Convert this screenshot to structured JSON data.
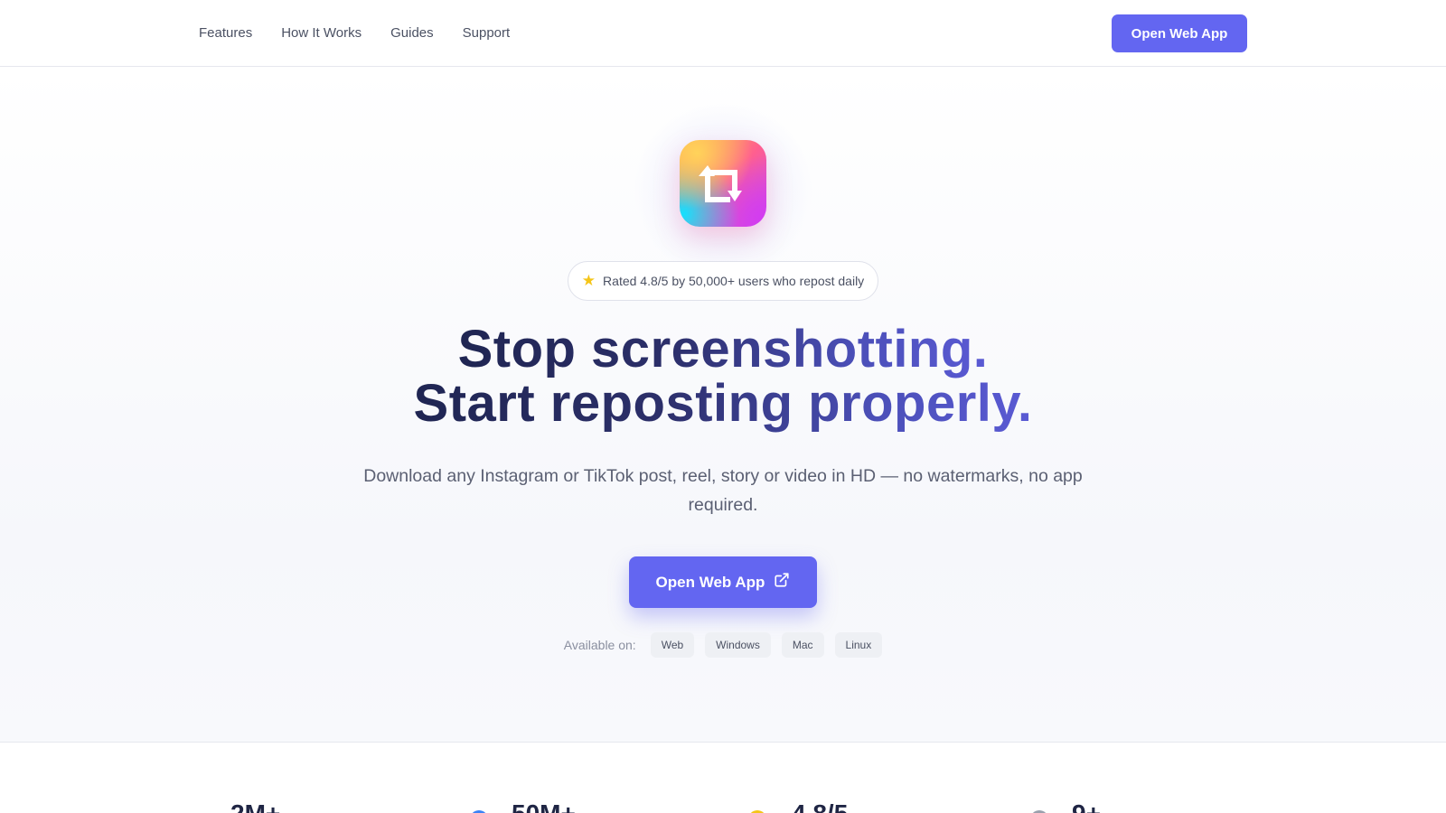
{
  "nav": {
    "links": [
      "Features",
      "How It Works",
      "Guides",
      "Support"
    ],
    "cta_label": "Open Web App"
  },
  "hero": {
    "icon": "repost-icon",
    "rating_icon": "star-icon",
    "rating_text": "Rated 4.8/5 by 50,000+ users who repost daily",
    "headline_line1": "Stop screenshotting.",
    "headline_line2": "Start reposting properly.",
    "subtitle": "Download any Instagram or TikTok post, reel, story or video in HD — no watermarks, no app required.",
    "cta_label": "Open Web App",
    "cta_icon": "external-link-icon",
    "available_label": "Available on:",
    "platforms": [
      "Web",
      "Windows",
      "Mac",
      "Linux"
    ]
  },
  "stats": [
    "2M+",
    "50M+",
    "4.8/5",
    "9+"
  ],
  "colors": {
    "accent": "#6366f1",
    "headline_dark": "#1f2552",
    "headline_light": "#5a5ad4"
  }
}
